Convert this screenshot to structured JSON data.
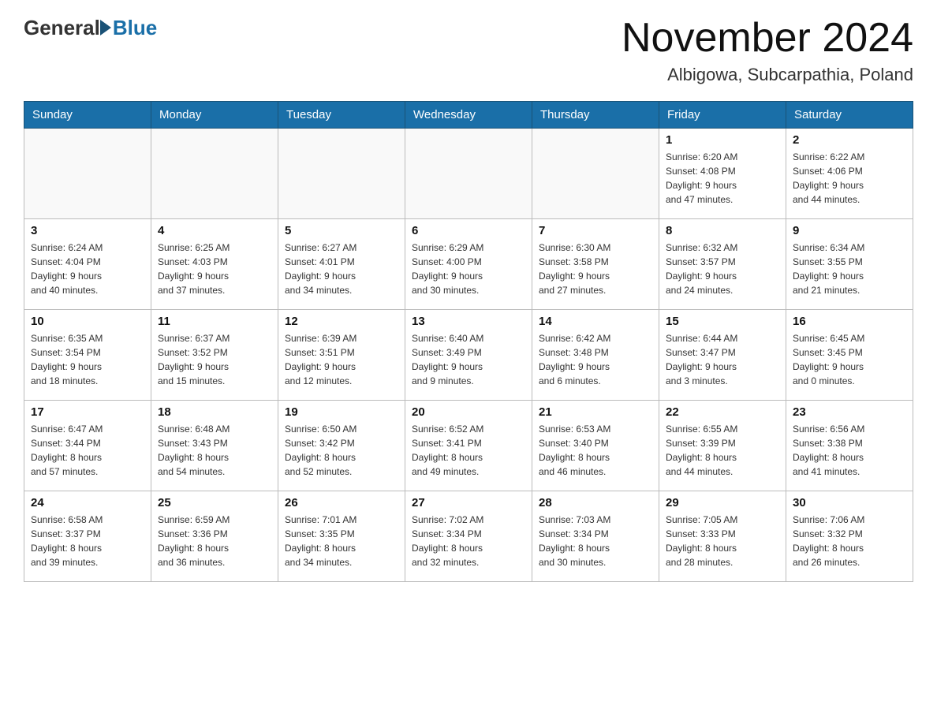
{
  "header": {
    "logo": {
      "general": "General",
      "blue": "Blue"
    },
    "title": "November 2024",
    "location": "Albigowa, Subcarpathia, Poland"
  },
  "days_of_week": [
    "Sunday",
    "Monday",
    "Tuesday",
    "Wednesday",
    "Thursday",
    "Friday",
    "Saturday"
  ],
  "weeks": [
    [
      {
        "day": "",
        "info": ""
      },
      {
        "day": "",
        "info": ""
      },
      {
        "day": "",
        "info": ""
      },
      {
        "day": "",
        "info": ""
      },
      {
        "day": "",
        "info": ""
      },
      {
        "day": "1",
        "info": "Sunrise: 6:20 AM\nSunset: 4:08 PM\nDaylight: 9 hours\nand 47 minutes."
      },
      {
        "day": "2",
        "info": "Sunrise: 6:22 AM\nSunset: 4:06 PM\nDaylight: 9 hours\nand 44 minutes."
      }
    ],
    [
      {
        "day": "3",
        "info": "Sunrise: 6:24 AM\nSunset: 4:04 PM\nDaylight: 9 hours\nand 40 minutes."
      },
      {
        "day": "4",
        "info": "Sunrise: 6:25 AM\nSunset: 4:03 PM\nDaylight: 9 hours\nand 37 minutes."
      },
      {
        "day": "5",
        "info": "Sunrise: 6:27 AM\nSunset: 4:01 PM\nDaylight: 9 hours\nand 34 minutes."
      },
      {
        "day": "6",
        "info": "Sunrise: 6:29 AM\nSunset: 4:00 PM\nDaylight: 9 hours\nand 30 minutes."
      },
      {
        "day": "7",
        "info": "Sunrise: 6:30 AM\nSunset: 3:58 PM\nDaylight: 9 hours\nand 27 minutes."
      },
      {
        "day": "8",
        "info": "Sunrise: 6:32 AM\nSunset: 3:57 PM\nDaylight: 9 hours\nand 24 minutes."
      },
      {
        "day": "9",
        "info": "Sunrise: 6:34 AM\nSunset: 3:55 PM\nDaylight: 9 hours\nand 21 minutes."
      }
    ],
    [
      {
        "day": "10",
        "info": "Sunrise: 6:35 AM\nSunset: 3:54 PM\nDaylight: 9 hours\nand 18 minutes."
      },
      {
        "day": "11",
        "info": "Sunrise: 6:37 AM\nSunset: 3:52 PM\nDaylight: 9 hours\nand 15 minutes."
      },
      {
        "day": "12",
        "info": "Sunrise: 6:39 AM\nSunset: 3:51 PM\nDaylight: 9 hours\nand 12 minutes."
      },
      {
        "day": "13",
        "info": "Sunrise: 6:40 AM\nSunset: 3:49 PM\nDaylight: 9 hours\nand 9 minutes."
      },
      {
        "day": "14",
        "info": "Sunrise: 6:42 AM\nSunset: 3:48 PM\nDaylight: 9 hours\nand 6 minutes."
      },
      {
        "day": "15",
        "info": "Sunrise: 6:44 AM\nSunset: 3:47 PM\nDaylight: 9 hours\nand 3 minutes."
      },
      {
        "day": "16",
        "info": "Sunrise: 6:45 AM\nSunset: 3:45 PM\nDaylight: 9 hours\nand 0 minutes."
      }
    ],
    [
      {
        "day": "17",
        "info": "Sunrise: 6:47 AM\nSunset: 3:44 PM\nDaylight: 8 hours\nand 57 minutes."
      },
      {
        "day": "18",
        "info": "Sunrise: 6:48 AM\nSunset: 3:43 PM\nDaylight: 8 hours\nand 54 minutes."
      },
      {
        "day": "19",
        "info": "Sunrise: 6:50 AM\nSunset: 3:42 PM\nDaylight: 8 hours\nand 52 minutes."
      },
      {
        "day": "20",
        "info": "Sunrise: 6:52 AM\nSunset: 3:41 PM\nDaylight: 8 hours\nand 49 minutes."
      },
      {
        "day": "21",
        "info": "Sunrise: 6:53 AM\nSunset: 3:40 PM\nDaylight: 8 hours\nand 46 minutes."
      },
      {
        "day": "22",
        "info": "Sunrise: 6:55 AM\nSunset: 3:39 PM\nDaylight: 8 hours\nand 44 minutes."
      },
      {
        "day": "23",
        "info": "Sunrise: 6:56 AM\nSunset: 3:38 PM\nDaylight: 8 hours\nand 41 minutes."
      }
    ],
    [
      {
        "day": "24",
        "info": "Sunrise: 6:58 AM\nSunset: 3:37 PM\nDaylight: 8 hours\nand 39 minutes."
      },
      {
        "day": "25",
        "info": "Sunrise: 6:59 AM\nSunset: 3:36 PM\nDaylight: 8 hours\nand 36 minutes."
      },
      {
        "day": "26",
        "info": "Sunrise: 7:01 AM\nSunset: 3:35 PM\nDaylight: 8 hours\nand 34 minutes."
      },
      {
        "day": "27",
        "info": "Sunrise: 7:02 AM\nSunset: 3:34 PM\nDaylight: 8 hours\nand 32 minutes."
      },
      {
        "day": "28",
        "info": "Sunrise: 7:03 AM\nSunset: 3:34 PM\nDaylight: 8 hours\nand 30 minutes."
      },
      {
        "day": "29",
        "info": "Sunrise: 7:05 AM\nSunset: 3:33 PM\nDaylight: 8 hours\nand 28 minutes."
      },
      {
        "day": "30",
        "info": "Sunrise: 7:06 AM\nSunset: 3:32 PM\nDaylight: 8 hours\nand 26 minutes."
      }
    ]
  ]
}
